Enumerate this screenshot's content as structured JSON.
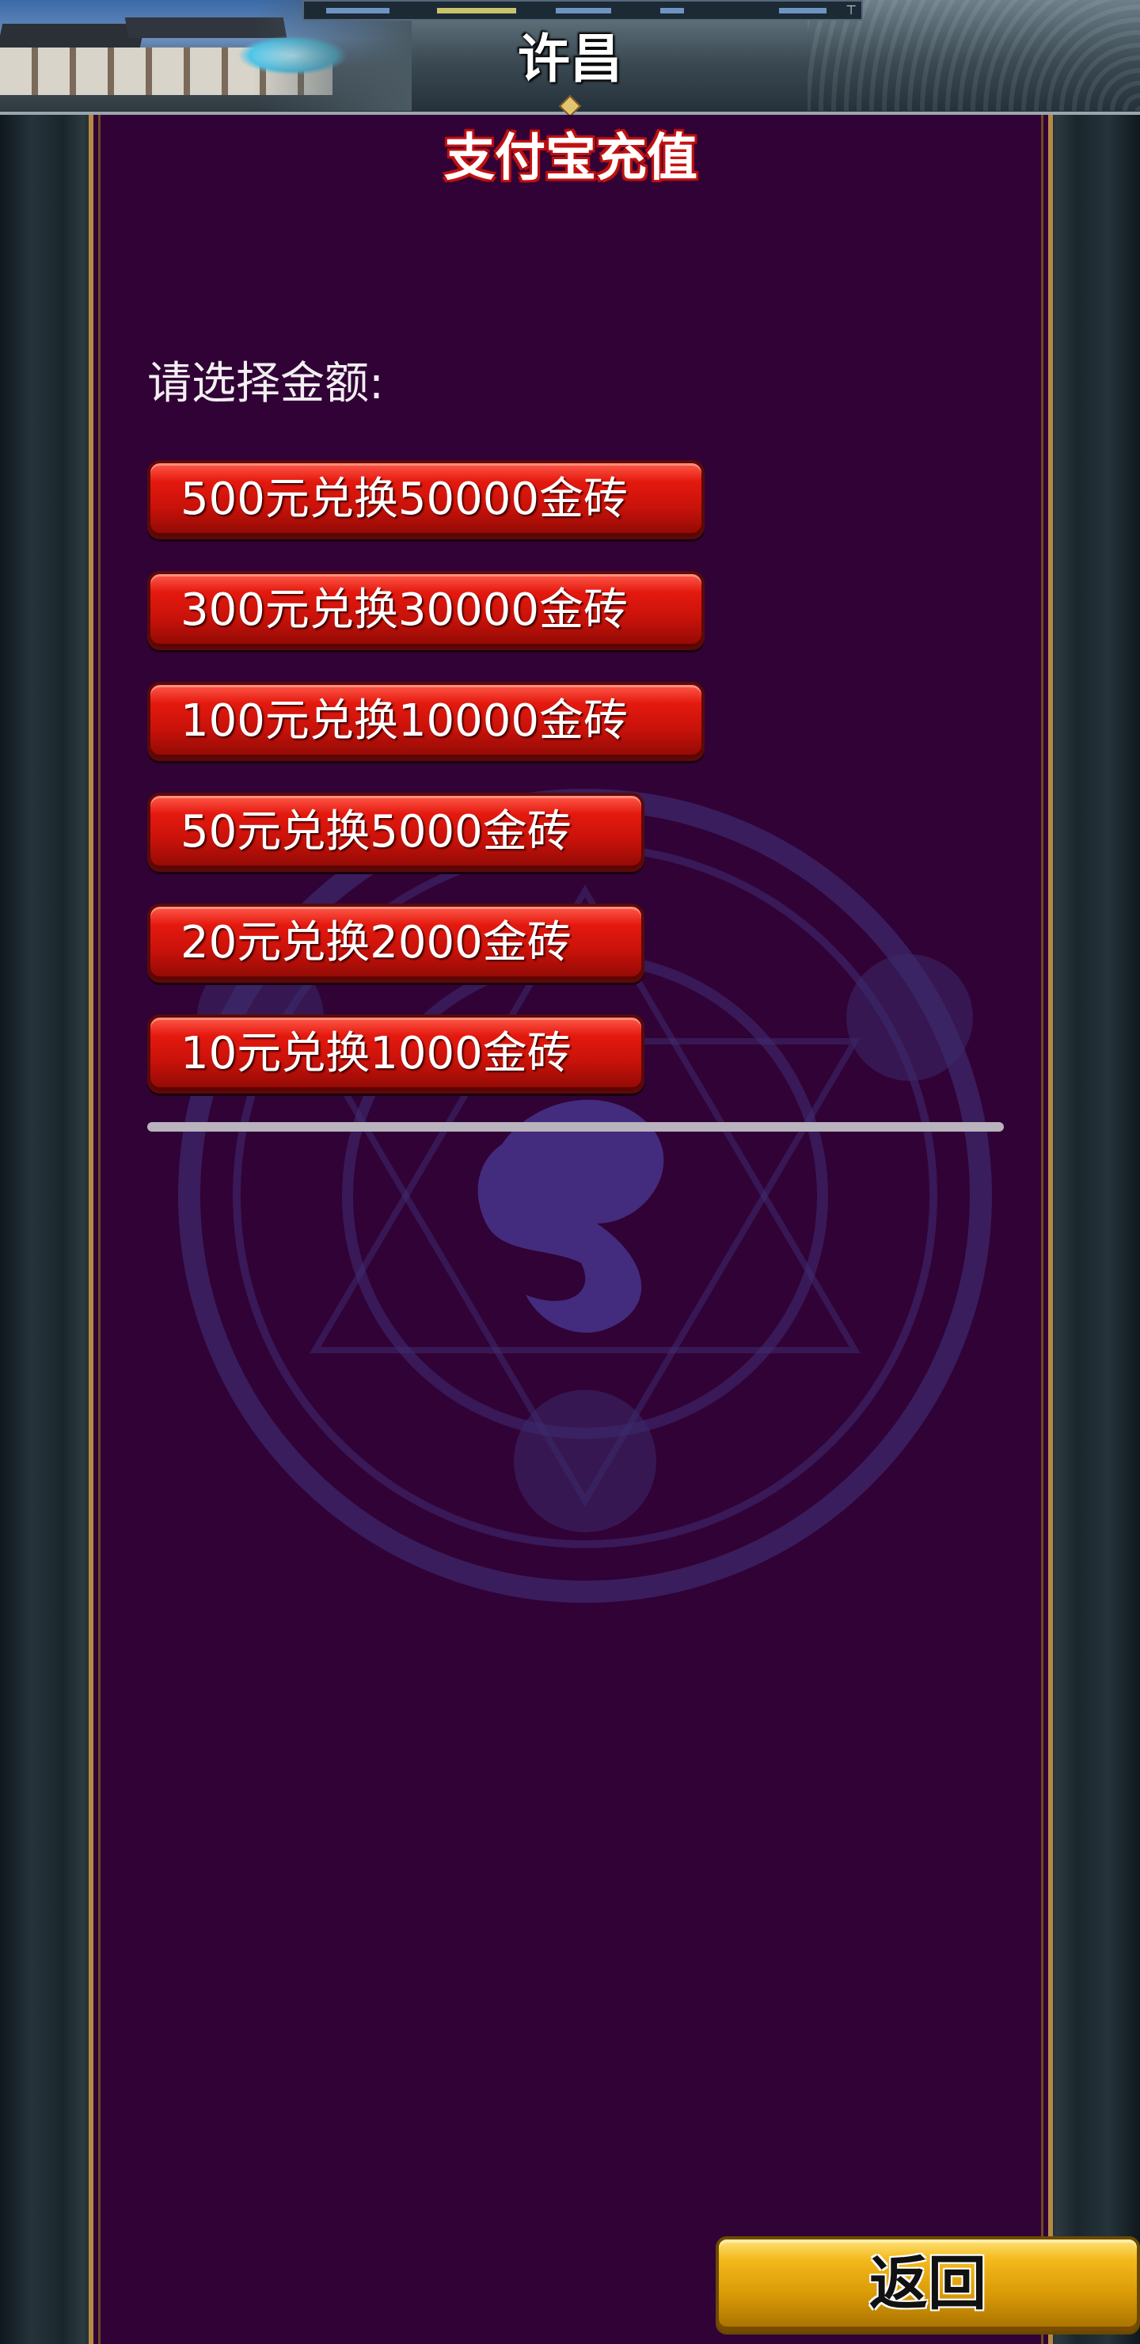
{
  "header": {
    "city_title": "许昌"
  },
  "panel": {
    "title": "支付宝充值",
    "prompt": "请选择金额:",
    "options": [
      {
        "label": "500元兑换50000金砖"
      },
      {
        "label": "300元兑换30000金砖"
      },
      {
        "label": "100元兑换10000金砖"
      },
      {
        "label": "50元兑换5000金砖"
      },
      {
        "label": "20元兑换2000金砖"
      },
      {
        "label": "10元兑换1000金砖"
      }
    ]
  },
  "footer": {
    "back_label": "返回"
  },
  "colors": {
    "panel_bg": "#310235",
    "panel_border": "#b58a45",
    "button_red": "#c9120a",
    "button_gold": "#d99a06"
  }
}
